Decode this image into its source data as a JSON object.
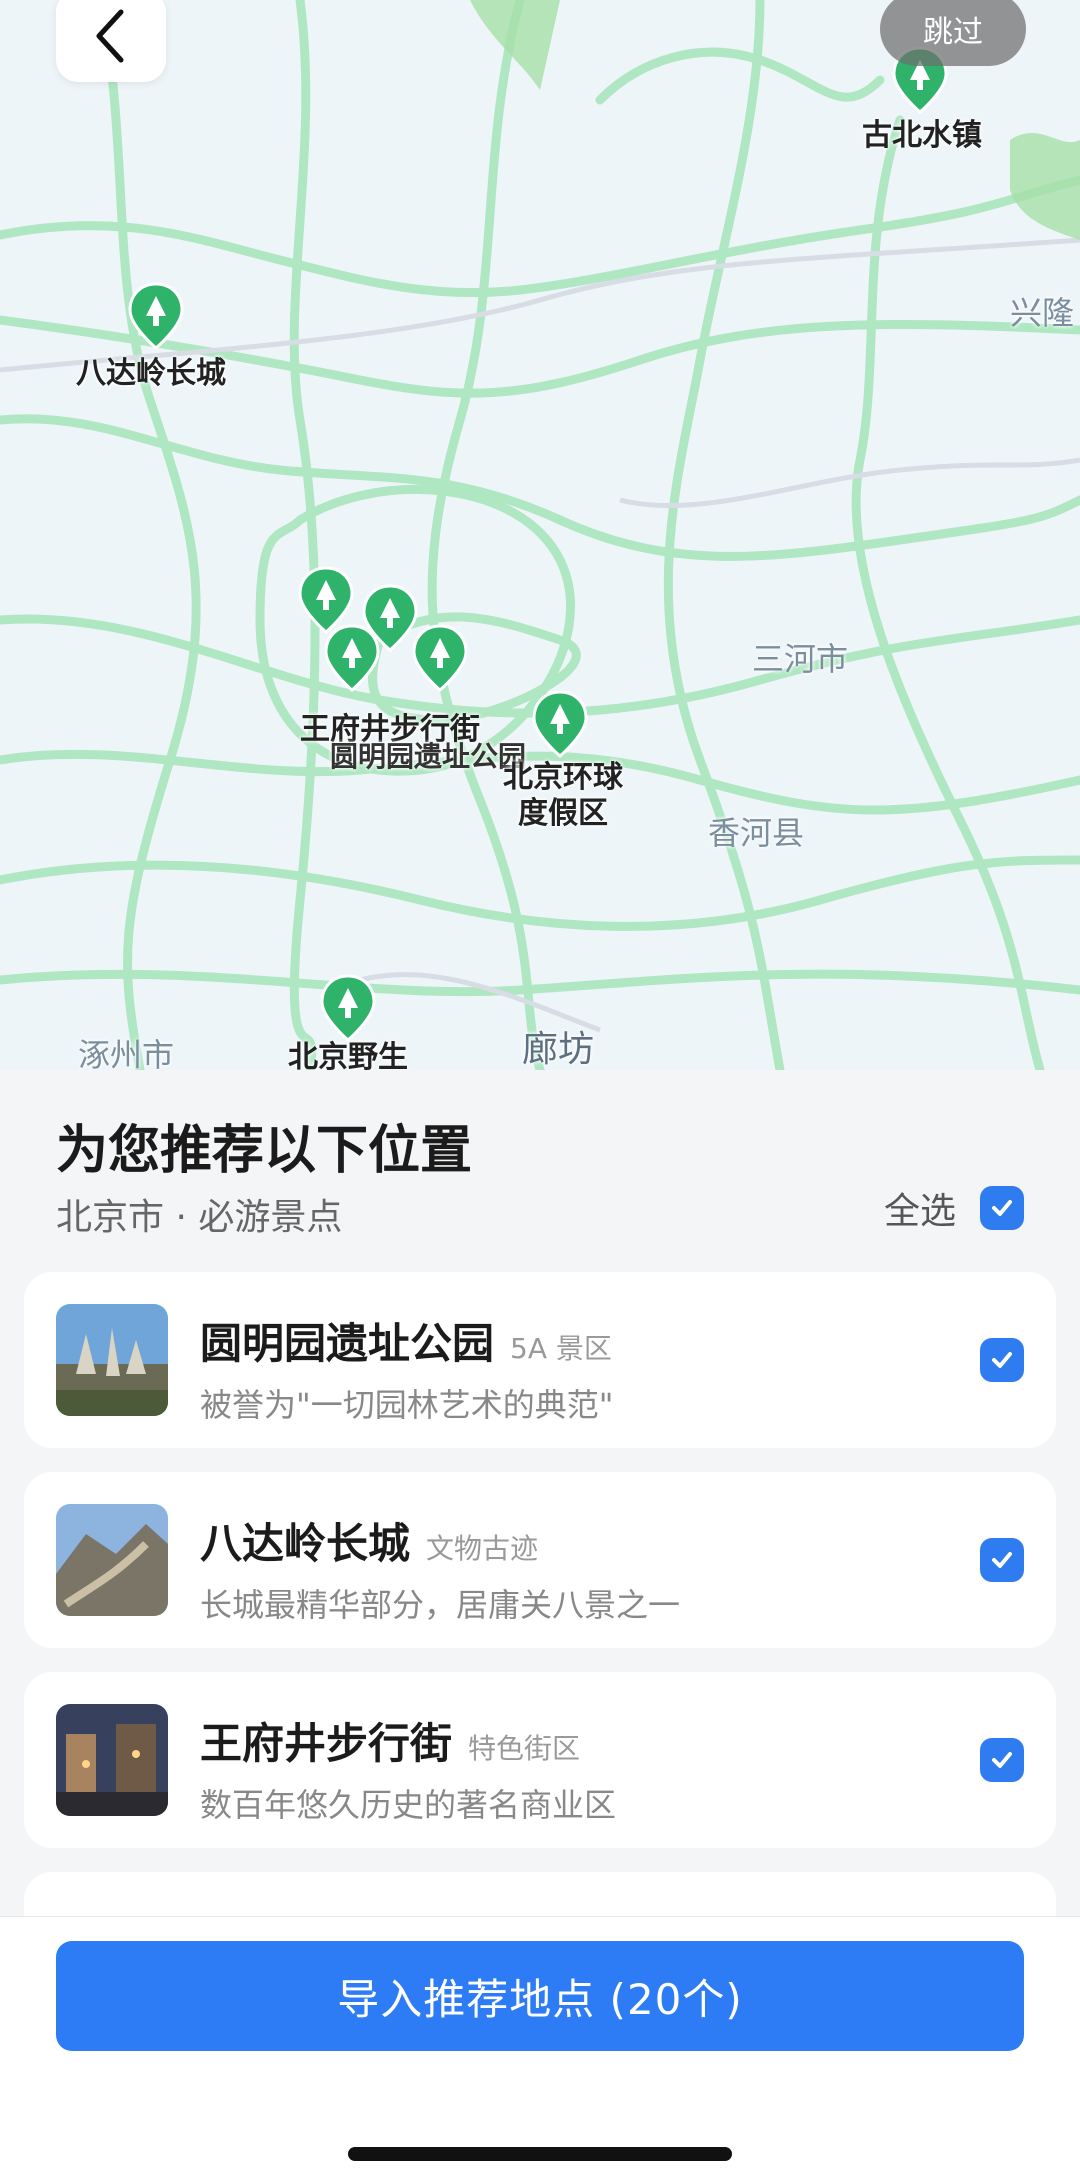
{
  "nav": {
    "back_icon": "chevron-left-icon",
    "skip_label": "跳过"
  },
  "map": {
    "places": [
      {
        "label": "古北水镇"
      },
      {
        "label": "八达岭长城"
      },
      {
        "label": "王府井步行街"
      },
      {
        "label": "圆明园遗址公园"
      },
      {
        "label": "北京环球度假区"
      },
      {
        "label": "北京野生"
      }
    ],
    "cities": [
      {
        "label": "兴隆"
      },
      {
        "label": "三河市"
      },
      {
        "label": "香河县"
      },
      {
        "label": "涿州市"
      },
      {
        "label": "廊坊"
      }
    ]
  },
  "sheet": {
    "title": "为您推荐以下位置",
    "subtitle": "北京市 · 必游景点",
    "select_all_label": "全选",
    "select_all_checked": true,
    "items": [
      {
        "name": "圆明园遗址公园",
        "tag": "5A 景区",
        "desc": "被誉为\"一切园林艺术的典范\"",
        "checked": true
      },
      {
        "name": "八达岭长城",
        "tag": "文物古迹",
        "desc": "长城最精华部分，居庸关八景之一",
        "checked": true
      },
      {
        "name": "王府井步行街",
        "tag": "特色街区",
        "desc": "数百年悠久历史的著名商业区",
        "checked": true
      }
    ]
  },
  "footer": {
    "import_label": "导入推荐地点 (20个)"
  },
  "colors": {
    "accent": "#2d7cf6",
    "pin_green": "#2fb36b",
    "road_green": "#8fdca7"
  }
}
